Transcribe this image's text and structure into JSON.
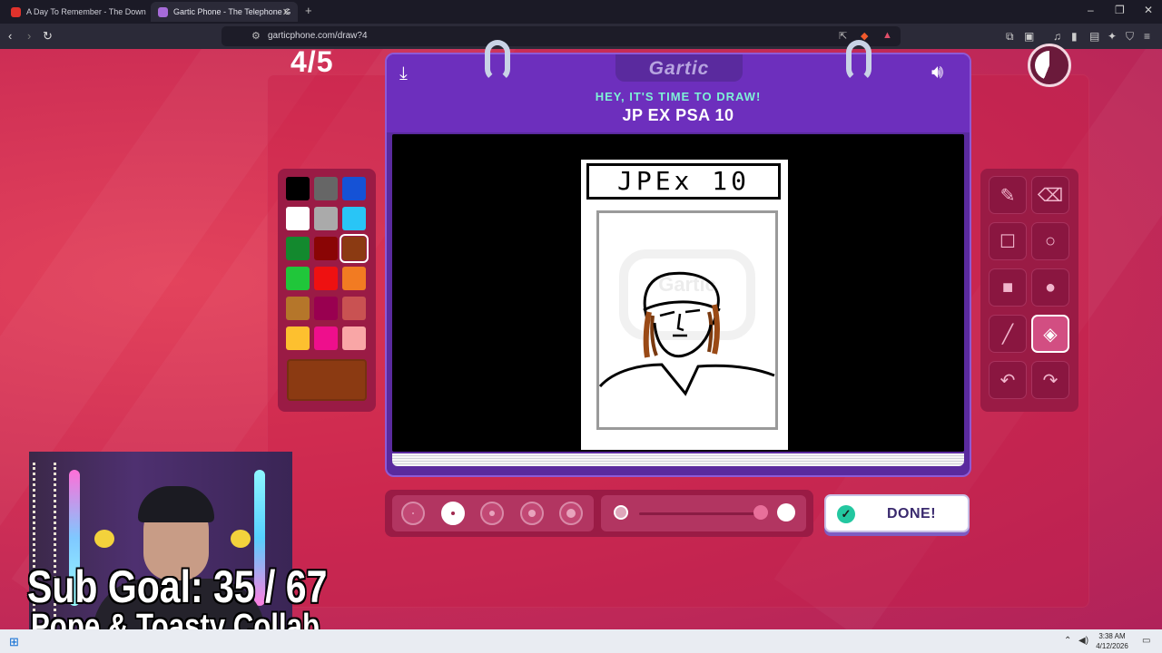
{
  "browser": {
    "tabs": [
      {
        "title": "A Day To Remember - The Down",
        "icon": "youtube-icon",
        "active": false
      },
      {
        "title": "Gartic Phone - The Telephone G",
        "icon": "gartic-icon",
        "active": true
      }
    ],
    "url": "garticphone.com/draw?4"
  },
  "game": {
    "round": "4/5",
    "logo": "Gartic",
    "instruction": "HEY, IT'S TIME TO DRAW!",
    "prompt": "JP EX PSA 10",
    "drawing_label": "JPEx 10",
    "watermark": "Gartic",
    "timer_remaining_fraction": 0.44,
    "colors": [
      "#000000",
      "#666666",
      "#1552d6",
      "#ffffff",
      "#aaaaaa",
      "#29c5f6",
      "#13892e",
      "#8a0505",
      "#8b3a12",
      "#20c63a",
      "#ee1111",
      "#f27b22",
      "#b5762a",
      "#990050",
      "#c95252",
      "#fdc02f",
      "#ee0f8c",
      "#f9a6a6"
    ],
    "selected_color_index": 8,
    "current_color": "#8b3a12",
    "tools": [
      "pencil-icon",
      "eraser-icon",
      "rectangle-outline-icon",
      "ellipse-outline-icon",
      "rectangle-fill-icon",
      "ellipse-fill-icon",
      "line-icon",
      "bucket-fill-icon",
      "undo-icon",
      "redo-icon"
    ],
    "selected_tool_index": 7,
    "brush_sizes": 5,
    "selected_brush_size_index": 1,
    "opacity_level": 0.9,
    "done_label": "DONE!"
  },
  "stream": {
    "sub_goal": "Sub Goal:   35 / 67",
    "collab": "Pope & Toasty Collab"
  },
  "taskbar": {
    "time": "3:38 AM",
    "date": "4/12/2026"
  }
}
